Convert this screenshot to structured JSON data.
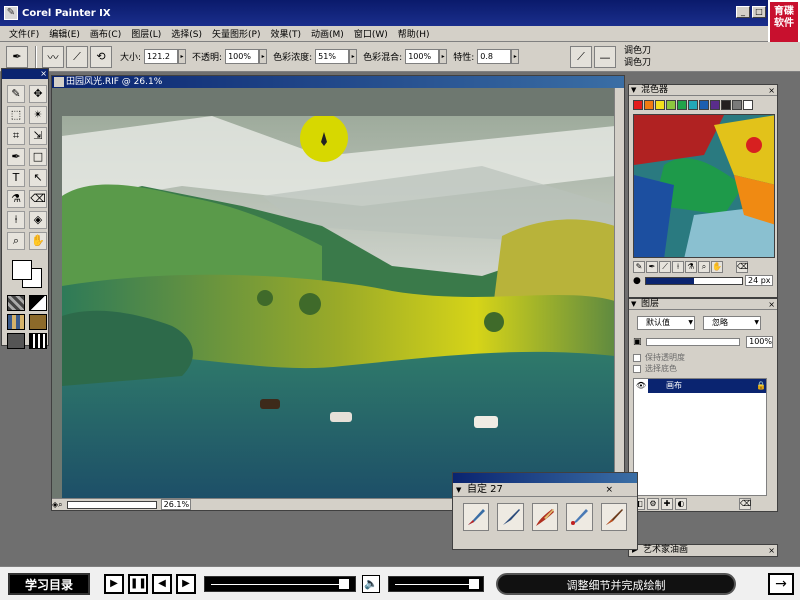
{
  "window": {
    "title": "Corel Painter IX",
    "min": "_",
    "max": "□",
    "close": "×",
    "brand": "育碟软件"
  },
  "menu": [
    "文件(F)",
    "编辑(E)",
    "画布(C)",
    "图层(L)",
    "选择(S)",
    "矢量图形(P)",
    "效果(T)",
    "动画(M)",
    "窗口(W)",
    "帮助(H)"
  ],
  "propbar": {
    "size_label": "大小:",
    "size_value": "121.2",
    "opacity_label": "不透明:",
    "opacity_value": "100%",
    "resat_label": "色彩浓度:",
    "resat_value": "51%",
    "bleed_label": "色彩混合:",
    "bleed_value": "100%",
    "jitter_label": "特性:",
    "jitter_value": "0.8",
    "brush_category": "调色刀",
    "brush_variant": "调色刀"
  },
  "toolbox": {
    "close": "×"
  },
  "document": {
    "title": "田园风光.RIF @ 26.1%",
    "zoom": "26.1%"
  },
  "mixer": {
    "title": "混色器",
    "close": "×",
    "brush_size": "24 px",
    "colors": [
      "#e31c1c",
      "#f07c12",
      "#f4e11b",
      "#8dc63f",
      "#21a24a",
      "#22a9b8",
      "#1c5fb0",
      "#5a2d8c",
      "#231f20",
      "#7a7a7a",
      "#ffffff"
    ]
  },
  "layers": {
    "title": "图层",
    "close": "×",
    "composite_method": "默认值",
    "blend_mode": "忽略",
    "opacity_value": "100%",
    "preserve_transparency": "保持透明度",
    "pick_up_color": "选择底色",
    "canvas_layer": "画布"
  },
  "custom_palette": {
    "title": "自定 27",
    "close": "×"
  },
  "artist_oils": {
    "title": "艺术家油画",
    "close": "×"
  },
  "player": {
    "course_button": "学习目录",
    "caption": "调整细节并完成绘制",
    "play": "▶",
    "pause": "❚❚",
    "prev": "◀",
    "next_frame": "▶",
    "next": "→"
  }
}
